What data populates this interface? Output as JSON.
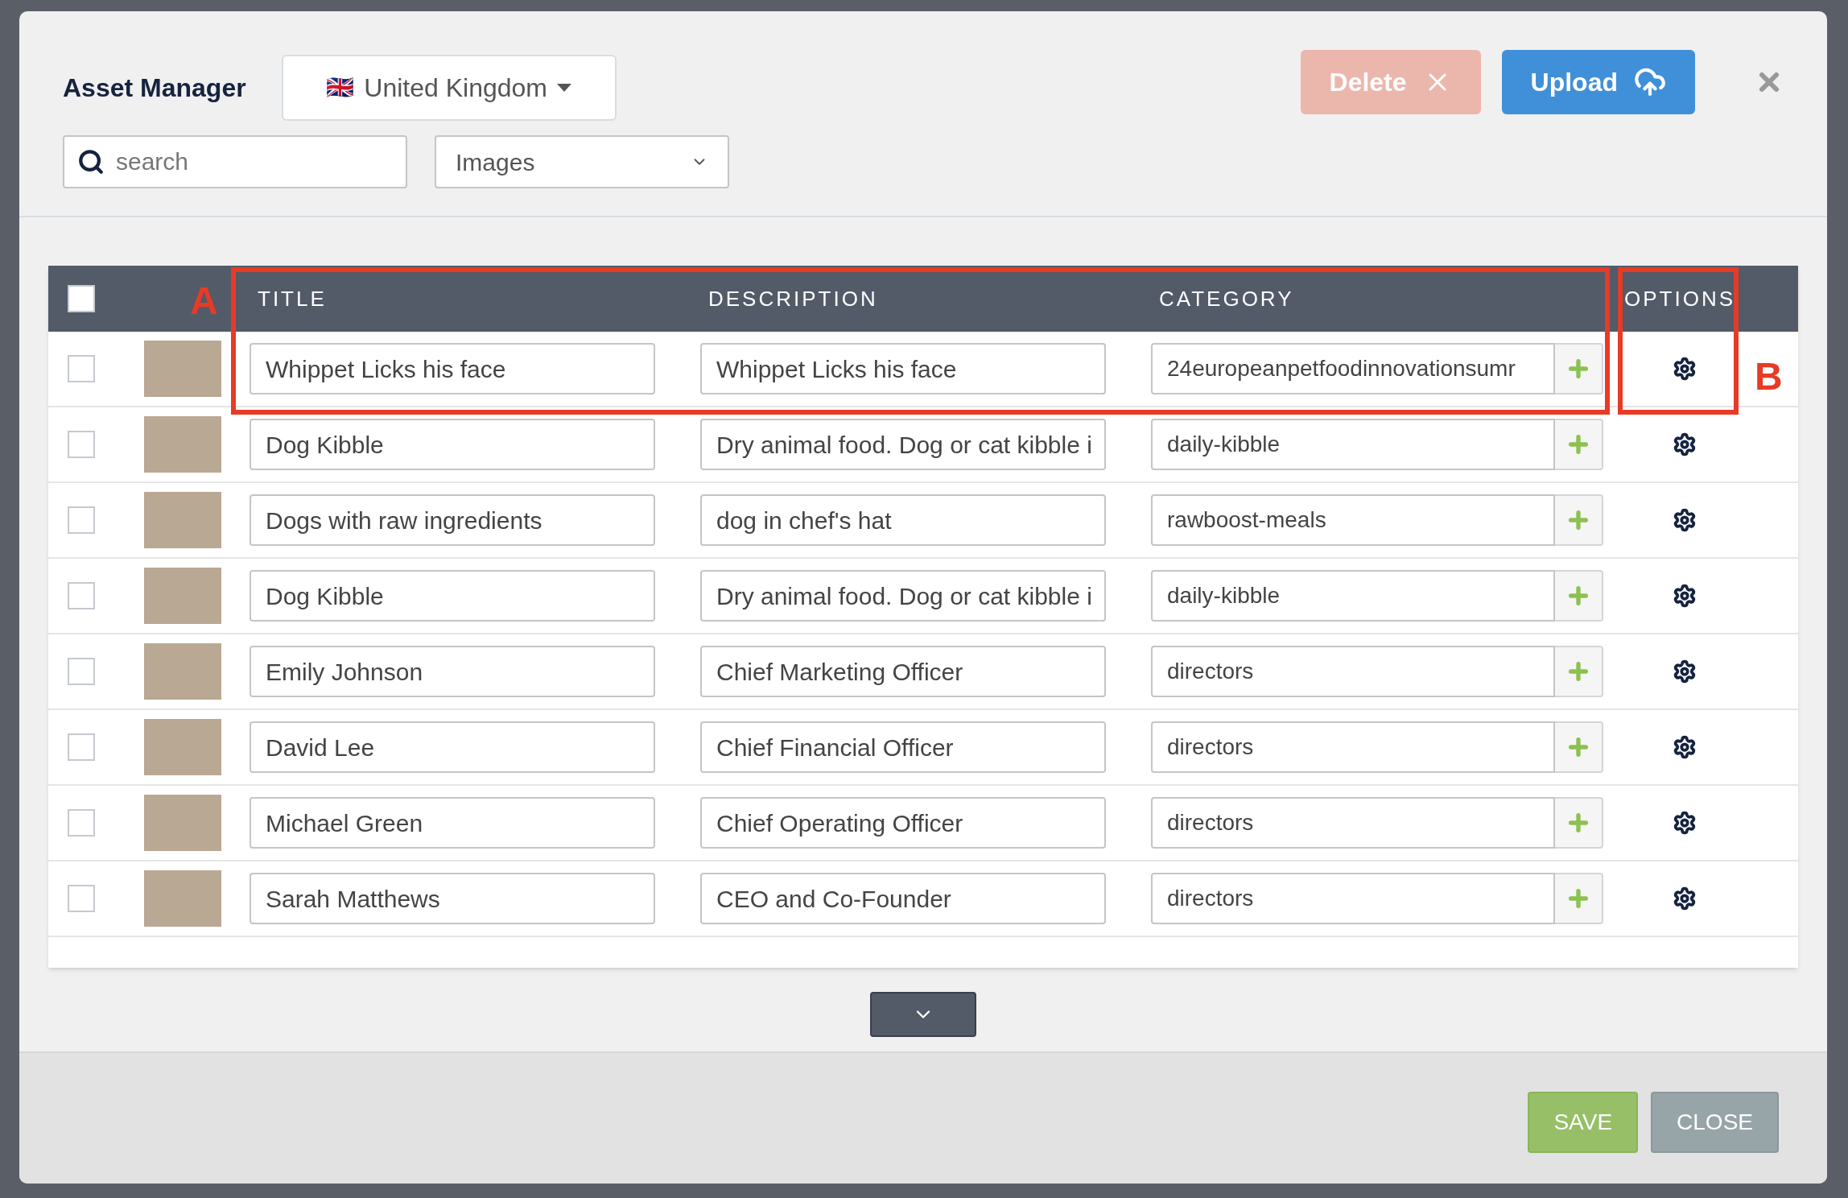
{
  "modal": {
    "title": "Asset Manager",
    "country": {
      "flag": "🇬🇧",
      "label": "United Kingdom"
    },
    "actions": [
      {
        "kind": "delete",
        "label": "Delete",
        "disabled": true
      },
      {
        "kind": "upload",
        "label": "Upload",
        "disabled": false
      }
    ],
    "search": {
      "placeholder": "search"
    },
    "type_filter": {
      "value": "Images"
    },
    "table": {
      "select_all": {
        "checked": false
      },
      "columns": [
        "TITLE",
        "DESCRIPTION",
        "CATEGORY",
        "OPTIONS"
      ],
      "rows": [
        {
          "checked": false,
          "title": "Whippet Licks his face",
          "description": "Whippet Licks his face",
          "category": "24europeanpetfoodinnovationsumr"
        },
        {
          "checked": false,
          "title": "Dog Kibble",
          "description": "Dry animal food. Dog or cat kibble i",
          "category": "daily-kibble"
        },
        {
          "checked": false,
          "title": "Dogs with raw ingredients",
          "description": "dog in chef's hat",
          "category": "rawboost-meals"
        },
        {
          "checked": false,
          "title": "Dog Kibble",
          "description": "Dry animal food. Dog or cat kibble i",
          "category": "daily-kibble"
        },
        {
          "checked": false,
          "title": "Emily Johnson",
          "description": "Chief Marketing Officer",
          "category": "directors"
        },
        {
          "checked": false,
          "title": "David Lee",
          "description": "Chief Financial Officer",
          "category": "directors"
        },
        {
          "checked": false,
          "title": "Michael Green",
          "description": "Chief Operating Officer",
          "category": "directors"
        },
        {
          "checked": false,
          "title": "Sarah Matthews",
          "description": "CEO and Co-Founder",
          "category": "directors"
        }
      ]
    },
    "annotations": [
      "A",
      "B"
    ],
    "footer": [
      {
        "kind": "save",
        "label": "SAVE"
      },
      {
        "kind": "close",
        "label": "CLOSE"
      }
    ]
  }
}
